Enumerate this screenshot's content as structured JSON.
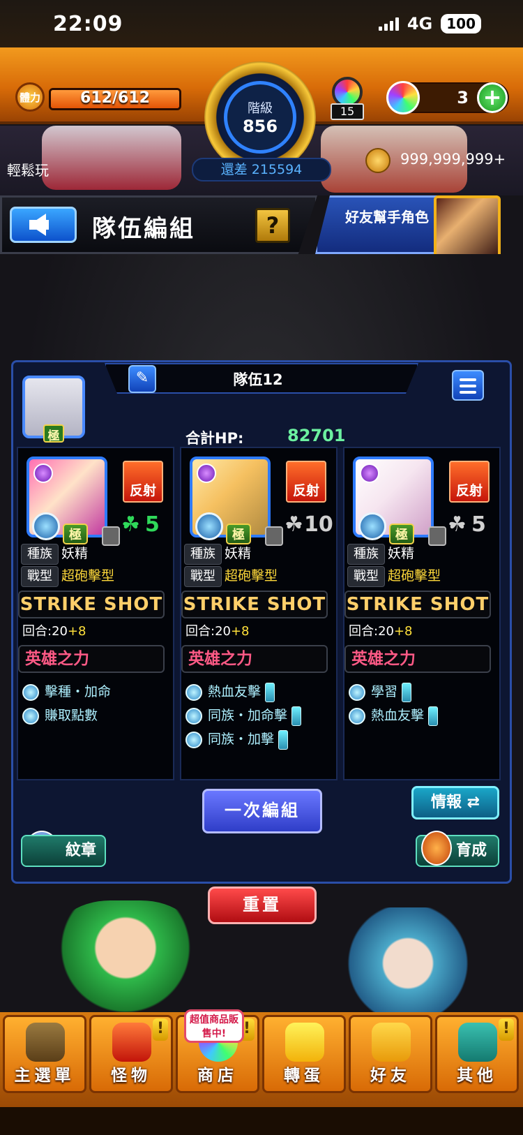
{
  "status_bar": {
    "time": "22:09",
    "network": "4G",
    "battery": "100"
  },
  "hud": {
    "stamina_label": "體力",
    "stamina": "612/612",
    "stamina_fraction": 1.0,
    "rank_label": "階級",
    "rank_value": "856",
    "rank_remaining": "還差 215594",
    "orb_item_count": "15",
    "orbs": "3",
    "coins": "999,999,999+",
    "easy_play": "輕鬆玩"
  },
  "header": {
    "title": "隊伍編組",
    "help_label": "?",
    "helper_label": "好友幫手角色"
  },
  "team": {
    "name": "隊伍12",
    "leader_badge": "極",
    "total_hp_label": "合計HP:",
    "total_hp_value": "82701",
    "slots": [
      {
        "element_color": "#8a2be2",
        "ability_badge": "反射",
        "kiwami": "極",
        "luck": "5",
        "luck_color": "#2fd85a",
        "tribe_label": "種族",
        "tribe": "妖精",
        "type_label": "戰型",
        "type": "超砲擊型",
        "strike_shot": "STRIKE SHOT",
        "turns_prefix": "回合:20",
        "turns_plus": "+8",
        "hero_label": "英雄之力",
        "abilities": [
          "擊種・加命",
          "賺取點數"
        ]
      },
      {
        "element_color": "#8a2be2",
        "ability_badge": "反射",
        "kiwami": "極",
        "luck": "10",
        "luck_color": "#d0d0d0",
        "tribe_label": "種族",
        "tribe": "妖精",
        "type_label": "戰型",
        "type": "超砲擊型",
        "strike_shot": "STRIKE SHOT",
        "turns_prefix": "回合:20",
        "turns_plus": "+8",
        "hero_label": "英雄之力",
        "abilities": [
          "熱血友擊",
          "同族・加命擊",
          "同族・加擊"
        ]
      },
      {
        "element_color": "#8a2be2",
        "ability_badge": "反射",
        "kiwami": "極",
        "luck": "5",
        "luck_color": "#d0d0d0",
        "tribe_label": "種族",
        "tribe": "妖精",
        "type_label": "戰型",
        "type": "超砲擊型",
        "strike_shot": "STRIKE SHOT",
        "turns_prefix": "回合:20",
        "turns_plus": "+8",
        "hero_label": "英雄之力",
        "abilities": [
          "學習",
          "熱血友擊"
        ]
      }
    ]
  },
  "actions": {
    "combine": "一次編組",
    "info": "情報 ⇄",
    "badge": "紋章",
    "train": "育成",
    "reset": "重置"
  },
  "nav": {
    "sale_badge": "超值商品販售中!",
    "items": [
      {
        "label": "主選單",
        "icon": "home-icon"
      },
      {
        "label": "怪物",
        "icon": "monster-icon",
        "alert": "!"
      },
      {
        "label": "商店",
        "icon": "shop-icon",
        "alert": "!"
      },
      {
        "label": "轉蛋",
        "icon": "gacha-icon"
      },
      {
        "label": "好友",
        "icon": "friends-icon"
      },
      {
        "label": "其他",
        "icon": "other-icon",
        "alert": "!"
      }
    ]
  }
}
